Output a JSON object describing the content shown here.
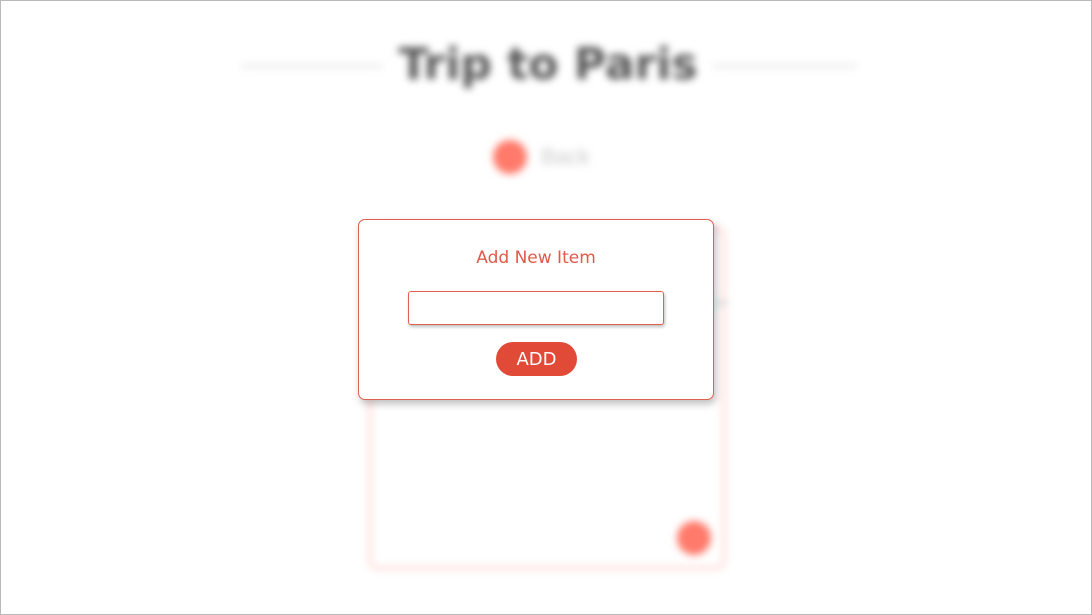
{
  "page": {
    "title": "Trip to Paris",
    "back_label": "Back"
  },
  "modal": {
    "title": "Add New Item",
    "input": {
      "value": "",
      "placeholder": ""
    },
    "add_label": "ADD"
  },
  "colors": {
    "accent": "#e04a36",
    "accent_light": "#ff7a6a",
    "modal_border": "#e0604e"
  }
}
